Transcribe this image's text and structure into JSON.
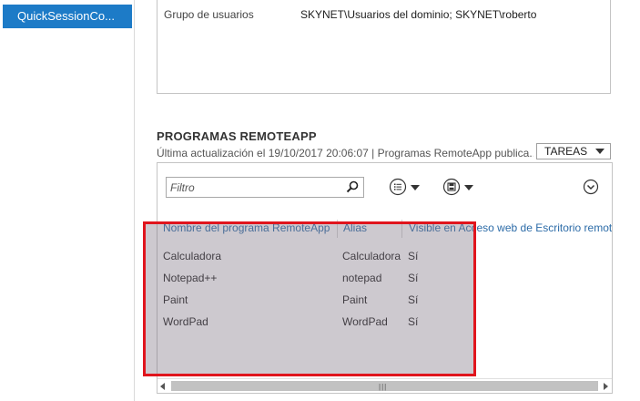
{
  "nav": {
    "item": "QuickSessionCo..."
  },
  "properties": {
    "label": "Grupo de usuarios",
    "value": "SKYNET\\Usuarios del dominio; SKYNET\\roberto"
  },
  "section": {
    "title": "PROGRAMAS REMOTEAPP",
    "subtitle": "Última actualización el 19/10/2017 20:06:07 | Programas RemoteApp publica...",
    "tasks_label": "TAREAS"
  },
  "toolbar": {
    "filter_placeholder": "Filtro",
    "icons": [
      "search-icon",
      "list-view-icon",
      "save-icon",
      "expand-icon"
    ]
  },
  "table": {
    "headers": [
      "Nombre del programa RemoteApp",
      "Alias",
      "Visible en Acceso web de Escritorio remot"
    ],
    "rows": [
      [
        "Calculadora",
        "Calculadora",
        "Sí"
      ],
      [
        "Notepad++",
        "notepad",
        "Sí"
      ],
      [
        "Paint",
        "Paint",
        "Sí"
      ],
      [
        "WordPad",
        "WordPad",
        "Sí"
      ]
    ]
  },
  "colors": {
    "nav_selected": "#1d7bc7",
    "header_link": "#2d6ca8",
    "highlight_border": "#e0151d",
    "highlight_fill": "#7b7282"
  }
}
